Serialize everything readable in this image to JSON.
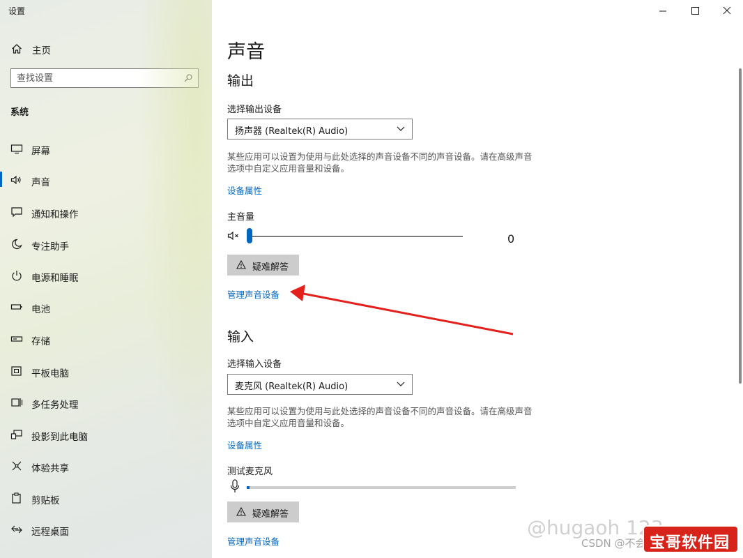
{
  "window": {
    "title": "设置",
    "caption": {
      "minimize": "minimize-icon",
      "maximize": "maximize-icon",
      "close": "close-icon"
    }
  },
  "sidebar": {
    "home": {
      "label": "主页",
      "icon": "home-icon"
    },
    "search": {
      "placeholder": "查找设置",
      "icon": "search-icon"
    },
    "group_title": "系统",
    "items": [
      {
        "label": "屏幕",
        "icon": "monitor-icon"
      },
      {
        "label": "声音",
        "icon": "speaker-icon",
        "active": true
      },
      {
        "label": "通知和操作",
        "icon": "notification-icon"
      },
      {
        "label": "专注助手",
        "icon": "moon-icon"
      },
      {
        "label": "电源和睡眠",
        "icon": "power-icon"
      },
      {
        "label": "电池",
        "icon": "battery-icon"
      },
      {
        "label": "存储",
        "icon": "storage-icon"
      },
      {
        "label": "平板电脑",
        "icon": "tablet-icon"
      },
      {
        "label": "多任务处理",
        "icon": "multitask-icon"
      },
      {
        "label": "投影到此电脑",
        "icon": "project-icon"
      },
      {
        "label": "体验共享",
        "icon": "share-icon"
      },
      {
        "label": "剪贴板",
        "icon": "clipboard-icon"
      },
      {
        "label": "远程桌面",
        "icon": "remote-desktop-icon"
      }
    ],
    "accent_color": "#0067c0"
  },
  "main": {
    "title": "声音",
    "output": {
      "title": "输出",
      "device_label": "选择输出设备",
      "device_value": "扬声器 (Realtek(R) Audio)",
      "description": "某些应用可以设置为使用与此处选择的声音设备不同的声音设备。请在高级声音选项中自定义应用音量和设备。",
      "properties_link": "设备属性",
      "volume_label": "主音量",
      "volume_value": "0",
      "volume_icon": "speaker-muted-icon",
      "troubleshoot": "疑难解答",
      "manage_link": "管理声音设备"
    },
    "input": {
      "title": "输入",
      "device_label": "选择输入设备",
      "device_value": "麦克风 (Realtek(R) Audio)",
      "description": "某些应用可以设置为使用与此处选择的声音设备不同的声音设备。请在高级声音选项中自定义应用音量和设备。",
      "properties_link": "设备属性",
      "test_label": "测试麦克风",
      "mic_level": 0.01,
      "mic_icon": "microphone-icon",
      "troubleshoot": "疑难解答",
      "manage_link": "管理声音设备"
    },
    "link_color": "#0067c0",
    "annotation_arrow_color": "#e3201b"
  },
  "overlay": {
    "watermark": "@hugaoh 123",
    "watermark_small": "CSDN @不会创建自动",
    "badge": "宝哥软件园"
  }
}
